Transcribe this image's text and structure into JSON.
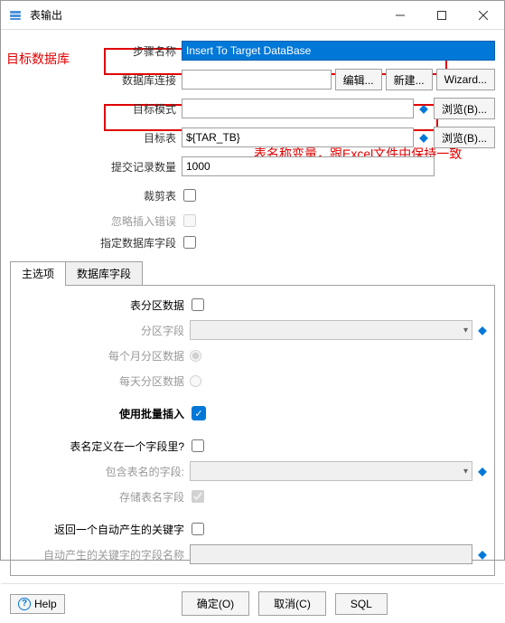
{
  "window": {
    "title": "表输出"
  },
  "annotations": {
    "target_db": "目标数据库",
    "varname_note": "表名称变量，跟Excel文件中保持一致"
  },
  "form": {
    "step_name": {
      "label": "步骤名称",
      "value": "Insert To Target DataBase"
    },
    "connection": {
      "label": "数据库连接",
      "value": "",
      "edit": "编辑...",
      "new_btn": "新建...",
      "wizard": "Wizard..."
    },
    "target_schema": {
      "label": "目标模式",
      "value": "",
      "browse": "浏览(B)..."
    },
    "target_table": {
      "label": "目标表",
      "value": "${TAR_TB}",
      "browse": "浏览(B)..."
    },
    "commit_size": {
      "label": "提交记录数量",
      "value": "1000"
    },
    "truncate": {
      "label": "裁剪表"
    },
    "ignore_err": {
      "label": "忽略插入错误"
    },
    "specify_fields": {
      "label": "指定数据库字段"
    }
  },
  "tabs": {
    "main": "主选项",
    "fields": "数据库字段"
  },
  "opts": {
    "partition": {
      "label": "表分区数据"
    },
    "part_field": {
      "label": "分区字段"
    },
    "monthly": {
      "label": "每个月分区数据"
    },
    "daily": {
      "label": "每天分区数据"
    },
    "batch": {
      "label": "使用批量插入"
    },
    "name_in_field": {
      "label": "表名定义在一个字段里?"
    },
    "name_field": {
      "label": "包含表名的字段:"
    },
    "store_name": {
      "label": "存储表名字段"
    },
    "return_key": {
      "label": "返回一个自动产生的关键字"
    },
    "key_field": {
      "label": "自动产生的关键字的字段名称"
    }
  },
  "footer": {
    "help": "Help",
    "ok": "确定(O)",
    "cancel": "取消(C)",
    "sql": "SQL"
  }
}
